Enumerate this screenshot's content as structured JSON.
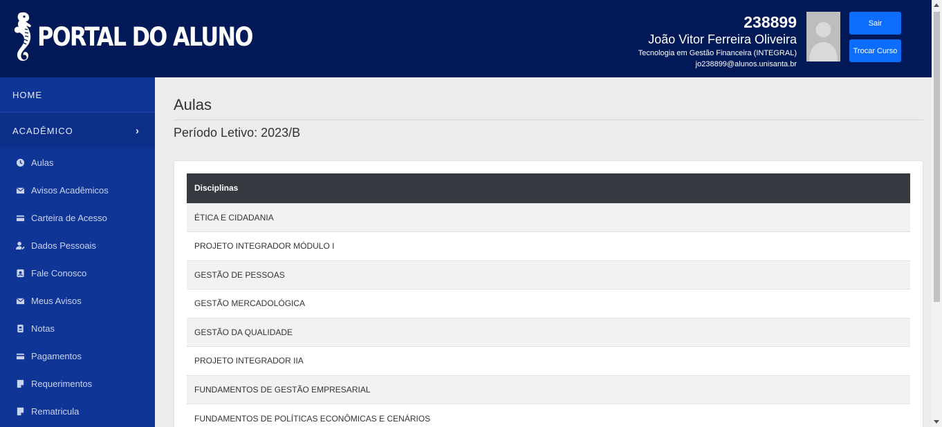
{
  "header": {
    "logo_text": "PORTAL DO ALUNO",
    "user_id": "238899",
    "user_name": "João Vitor Ferreira Oliveira",
    "course": "Tecnologia em Gestão Financeira (INTEGRAL)",
    "email": "jo238899@alunos.unisanta.br",
    "logout_label": "Sair",
    "change_course_label": "Trocar Curso"
  },
  "sidebar": {
    "home_label": "HOME",
    "academic_label": "ACADÊMICO",
    "items": [
      {
        "label": "Aulas",
        "icon": "clock-icon"
      },
      {
        "label": "Avisos Acadêmicos",
        "icon": "envelope-icon"
      },
      {
        "label": "Carteira de Acesso",
        "icon": "credit-card-icon"
      },
      {
        "label": "Dados Pessoais",
        "icon": "user-edit-icon"
      },
      {
        "label": "Fale Conosco",
        "icon": "contact-icon"
      },
      {
        "label": "Meus Avisos",
        "icon": "envelope-icon"
      },
      {
        "label": "Notas",
        "icon": "id-badge-icon"
      },
      {
        "label": "Pagamentos",
        "icon": "credit-card-icon"
      },
      {
        "label": "Requerimentos",
        "icon": "note-icon"
      },
      {
        "label": "Rematricula",
        "icon": "note-icon"
      }
    ]
  },
  "main": {
    "title": "Aulas",
    "periodo": "Período Letivo: 2023/B",
    "table": {
      "header": "Disciplinas",
      "rows": [
        "ÉTICA E CIDADANIA",
        "PROJETO INTEGRADOR MÓDULO I",
        "GESTÃO DE PESSOAS",
        "GESTÃO MERCADOLÓGICA",
        "GESTÃO DA QUALIDADE",
        "PROJETO INTEGRADOR IIA",
        "FUNDAMENTOS DE GESTÃO EMPRESARIAL",
        "FUNDAMENTOS DE POLÍTICAS ECONÔMICAS E CENÁRIOS"
      ]
    }
  },
  "colors": {
    "header_bg": "#011a57",
    "sidebar_bg": "#0f3597",
    "button_bg": "#0d6efd",
    "table_header_bg": "#343a40"
  }
}
